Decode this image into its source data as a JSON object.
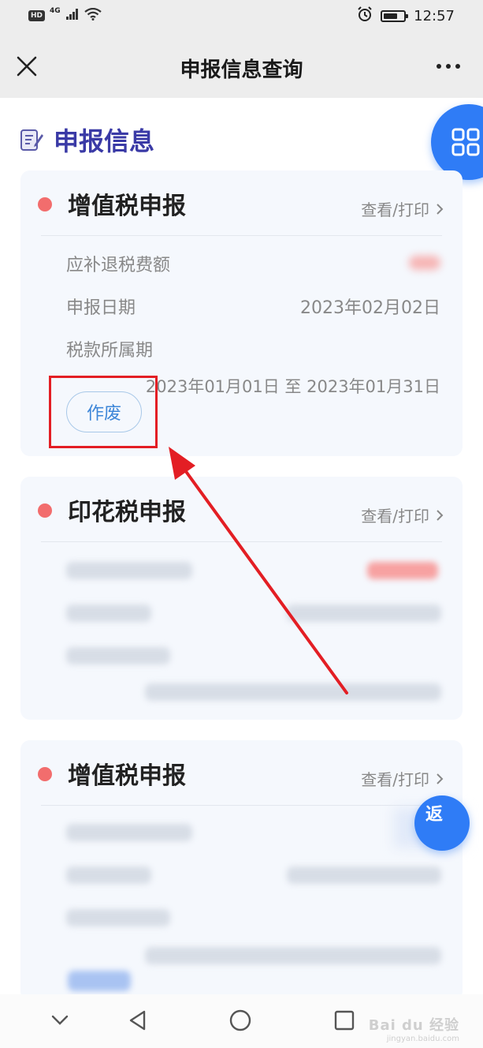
{
  "status_bar": {
    "hd": "HD",
    "network": "4G",
    "time": "12:57",
    "battery_level": 0.7
  },
  "header": {
    "title": "申报信息查询"
  },
  "section": {
    "title": "申报信息"
  },
  "cards": [
    {
      "title": "增值税申报",
      "action": "查看/打印",
      "rows": [
        {
          "label": "应补退税费额"
        },
        {
          "label": "申报日期",
          "value": "2023年02月02日"
        },
        {
          "label": "税款所属期",
          "value": "2023年01月01日 至 2023年01月31日"
        }
      ],
      "button": "作废"
    },
    {
      "title": "印花税申报",
      "action": "查看/打印"
    },
    {
      "title": "增值税申报",
      "action": "查看/打印"
    }
  ],
  "float_back": {
    "label": "返"
  },
  "watermark": {
    "logo": "Bai du 经验",
    "url": "jingyan.baidu.com"
  },
  "colors": {
    "accent": "#2f7cf6",
    "dot": "#f26d6d",
    "section_title": "#3a3aa6",
    "highlight": "#e31e24"
  }
}
